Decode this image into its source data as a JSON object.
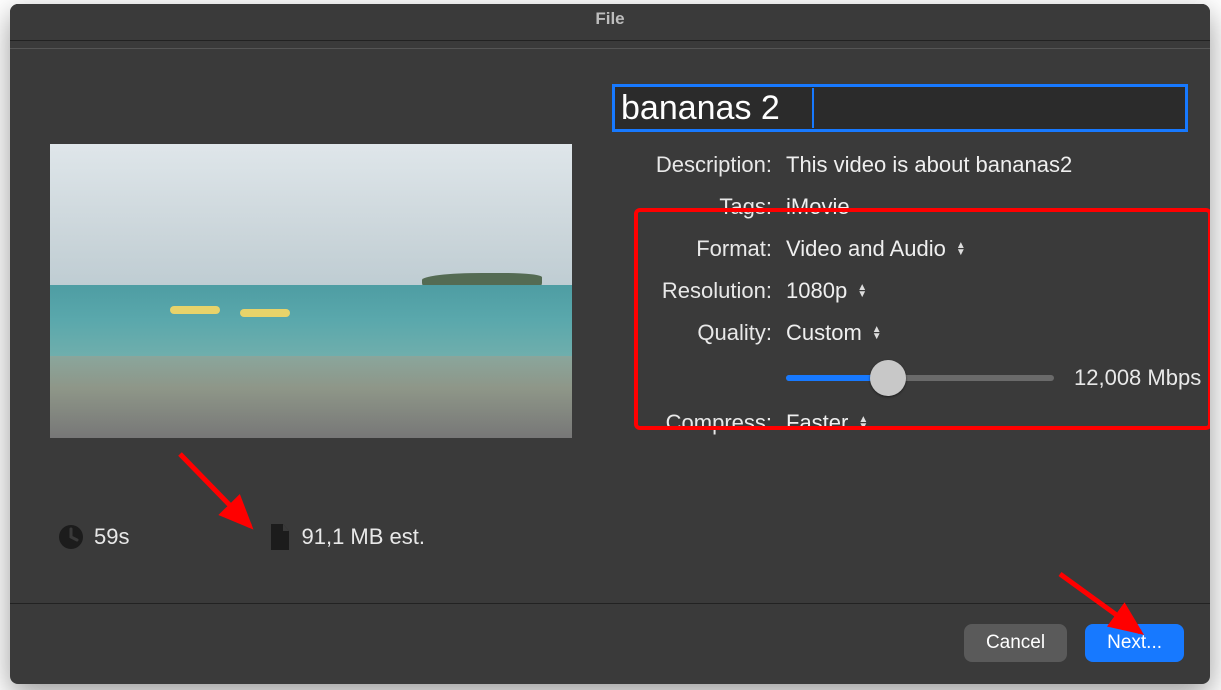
{
  "window": {
    "title": "File"
  },
  "title_field": {
    "value": "bananas 2"
  },
  "form": {
    "description": {
      "label": "Description:",
      "value": "This video is about bananas2"
    },
    "tags": {
      "label": "Tags:",
      "value": "iMovie"
    },
    "format": {
      "label": "Format:",
      "value": "Video and Audio"
    },
    "resolution": {
      "label": "Resolution:",
      "value": "1080p"
    },
    "quality": {
      "label": "Quality:",
      "value": "Custom"
    },
    "bitrate": {
      "value": "12,008 Mbps"
    },
    "compress": {
      "label": "Compress:",
      "value": "Faster"
    }
  },
  "preview": {
    "duration": "59s",
    "size_est": "91,1 MB est."
  },
  "buttons": {
    "cancel": "Cancel",
    "next": "Next..."
  }
}
